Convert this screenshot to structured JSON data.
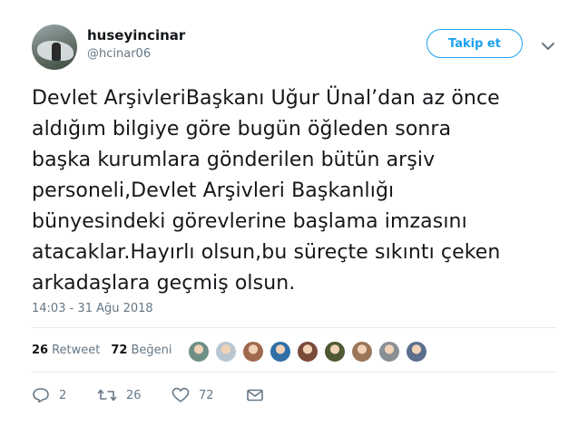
{
  "user": {
    "display_name": "huseyincinar",
    "handle": "@hcinar06",
    "avatar_icon": "user-avatar-photo"
  },
  "follow_button": {
    "label": "Takip et"
  },
  "tweet": {
    "lines": [
      "Devlet ArşivleriBaşkanı Uğur Ünal’dan az önce",
      "aldığım bilgiye göre bugün öğleden sonra",
      "başka kurumlara gönderilen bütün arşiv",
      "personeli,Devlet Arşivleri Başkanlığı",
      "bünyesindeki görevlerine başlama imzasını",
      "atacaklar.Hayırlı olsun,bu süreçte sıkıntı çeken",
      "arkadaşlara geçmiş olsun."
    ],
    "timestamp": "14:03 - 31 Ağu 2018"
  },
  "stats": {
    "retweets_count": "26",
    "retweets_label": "Retweet",
    "likes_count": "72",
    "likes_label": "Beğeni"
  },
  "likers": [
    {
      "color": "#6f8f86"
    },
    {
      "color": "#b9c7d3"
    },
    {
      "color": "#a06a4e"
    },
    {
      "color": "#2f6fa6"
    },
    {
      "color": "#7a4a3a"
    },
    {
      "color": "#4f5a34"
    },
    {
      "color": "#9b7659"
    },
    {
      "color": "#8a8f95"
    },
    {
      "color": "#5b6f8c"
    }
  ],
  "actions": {
    "reply_count": "2",
    "retweet_count": "26",
    "like_count": "72"
  },
  "colors": {
    "accent": "#1da1f2",
    "text": "#14171a",
    "muted": "#657786",
    "divider": "#e6ecf0"
  }
}
